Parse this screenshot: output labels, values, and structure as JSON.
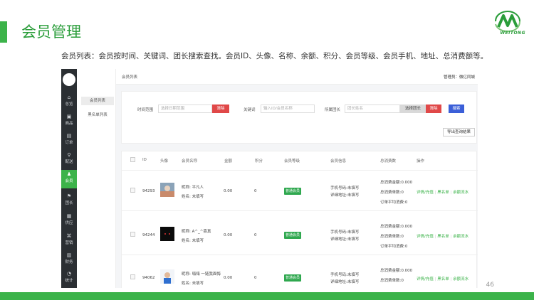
{
  "slide": {
    "title": "会员管理",
    "subtitle": "会员列表：会员按时间、关键词、团长搜索查找。会员ID、头像、名称、余额、积分、会员等级、会员手机、地址、总消费额等。",
    "logo_text": "WEITONG",
    "page_number": "46",
    "accent_color": "#3cb34a"
  },
  "sidenav": {
    "items": [
      {
        "icon": "home-icon",
        "glyph": "⌂",
        "label": "总览"
      },
      {
        "icon": "product-icon",
        "glyph": "▣",
        "label": "商品"
      },
      {
        "icon": "order-icon",
        "glyph": "▤",
        "label": "订单"
      },
      {
        "icon": "delivery-icon",
        "glyph": "⚲",
        "label": "配送"
      },
      {
        "icon": "member-icon",
        "glyph": "♟",
        "label": "会员"
      },
      {
        "icon": "leader-icon",
        "glyph": "⚑",
        "label": "团长"
      },
      {
        "icon": "supplier-icon",
        "glyph": "▦",
        "label": "供应"
      },
      {
        "icon": "marketing-icon",
        "glyph": "⌘",
        "label": "营销"
      },
      {
        "icon": "finance-icon",
        "glyph": "▥",
        "label": "财务"
      },
      {
        "icon": "stats-icon",
        "glyph": "◔",
        "label": "统计"
      }
    ]
  },
  "subnav": {
    "items": [
      "会员列表",
      "黑名单列表"
    ]
  },
  "topbar": {
    "breadcrumb": "会员列表",
    "admin_label": "管理员：微亿同城"
  },
  "filters": {
    "time_label": "时间范围",
    "time_placeholder": "选择日期范围",
    "clear_label": "清除",
    "keyword_label": "关键词",
    "keyword_placeholder": "输入ID/会员名称",
    "leader_label": "所属团长",
    "leader_placeholder": "团长姓名",
    "select_leader_label": "选择团长",
    "clear2_label": "清除",
    "search_label": "搜索",
    "export_label": "导出查询结果"
  },
  "table": {
    "columns": [
      "ID",
      "头像",
      "会员名称",
      "金额",
      "积分",
      "会员等级",
      "会员信息",
      "总消费数",
      "操作"
    ],
    "rows": [
      {
        "id": "94293",
        "nickname": "昵称: 平凡人",
        "realname": "姓名: 未填写",
        "amount": "0.00",
        "points": "0",
        "level": "普通会员",
        "phone": "手机号码:未填写",
        "address": "详细地址:未填写",
        "total_amount": "总消费金额:0.000",
        "total_orders": "总消费单数:0",
        "avg_order": "订单平均消费:0",
        "op_detail": "详情/充值",
        "op_blacklist": "黑名单",
        "op_balance": "余额流水"
      },
      {
        "id": "94244",
        "nickname": "昵称: A^_^喜真",
        "realname": "姓名: 未填写",
        "amount": "0.00",
        "points": "0",
        "level": "普通会员",
        "phone": "手机号码:未填写",
        "address": "详细地址:未填写",
        "total_amount": "总消费金额:0.000",
        "total_orders": "总消费单数:0",
        "avg_order": "订单平均消费:0",
        "op_detail": "详情/充值",
        "op_blacklist": "黑名单",
        "op_balance": "余额流水"
      },
      {
        "id": "94062",
        "nickname": "昵称: 嗨嗨 一链我面悔",
        "realname": "姓名: 未填写",
        "amount": "0.00",
        "points": "0",
        "level": "普通会员",
        "phone": "手机号码:未填写",
        "address": "详细地址:未填写",
        "total_amount": "总消费金额:0.000",
        "total_orders": "总消费单数:0",
        "avg_order": "",
        "op_detail": "详情/充值",
        "op_blacklist": "黑名单",
        "op_balance": "余额流水"
      }
    ]
  }
}
